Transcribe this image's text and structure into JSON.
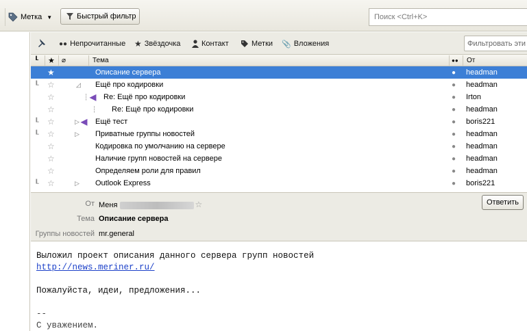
{
  "toolbar": {
    "tag_label": "Метка",
    "quick_filter_label": "Быстрый фильтр",
    "search_placeholder": "Поиск <Ctrl+K>"
  },
  "filterbar": {
    "unread": "Непрочитанные",
    "starred": "Звёздочка",
    "contact": "Контакт",
    "tags": "Метки",
    "attachments": "Вложения",
    "filter_placeholder": "Фильтровать эти"
  },
  "columns": {
    "subject": "Тема",
    "from": "От"
  },
  "messages": [
    {
      "subject": "Описание сервера",
      "from": "headman"
    },
    {
      "subject": "Ещё про кодировки",
      "from": "headman"
    },
    {
      "subject": "Re: Ещё про кодировки",
      "from": "Irton"
    },
    {
      "subject": "Re: Ещё про кодировки",
      "from": "headman"
    },
    {
      "subject": "Ещё тест",
      "from": "boris221"
    },
    {
      "subject": "Приватные группы новостей",
      "from": "headman"
    },
    {
      "subject": "Кодировка по умолчанию на сервере",
      "from": "headman"
    },
    {
      "subject": "Наличие групп новостей на сервере",
      "from": "headman"
    },
    {
      "subject": "Определяем роли для правил",
      "from": "headman"
    },
    {
      "subject": "Outlook Express",
      "from": "boris221"
    }
  ],
  "header": {
    "from_label": "От",
    "from_value": "Меня",
    "subject_label": "Тема",
    "subject_value": "Описание сервера",
    "groups_label": "Группы новостей",
    "groups_value": "mr.general",
    "reply_button": "Ответить"
  },
  "body": {
    "line1": "Выложил проект описания данного сервера групп новостей",
    "link": "http://news.meriner.ru/",
    "line3": "Пожалуйста, идеи, предложения...",
    "sig_sep": "--",
    "sig": "С уважением."
  },
  "colors": {
    "selection": "#3c7fd6",
    "reply_arrow": "#7a4cb8",
    "link": "#1a3fc8"
  }
}
